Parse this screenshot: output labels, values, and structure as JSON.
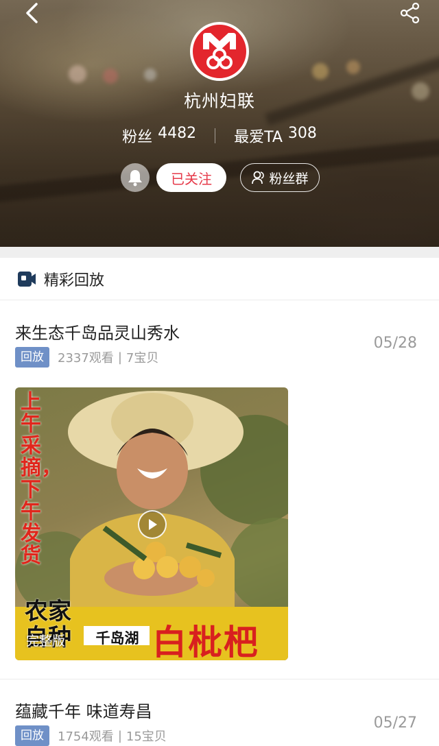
{
  "header": {
    "back_icon": "back-arrow-icon",
    "share_icon": "share-icon",
    "logo_icon": "womens-federation-emblem-icon",
    "name": "杭州妇联",
    "fans_label": "粉丝",
    "fans_count": "4482",
    "favorite_label": "最爱TA",
    "favorite_count": "308",
    "bell_icon": "bell-icon",
    "follow_label": "已关注",
    "fans_group_label": "粉丝群",
    "fans_group_icon": "group-icon"
  },
  "section": {
    "icon": "video-camera-icon",
    "title": "精彩回放"
  },
  "items": [
    {
      "title": "来生态千岛品灵山秀水",
      "badge": "回放",
      "views": "2337观看",
      "separator": "|",
      "goods": "7宝贝",
      "date": "05/28",
      "thumb": {
        "vertical_text": "上午采摘，下午发货",
        "bottom_left": "农家自种",
        "brand": "千岛湖",
        "product": "白枇杷",
        "full_label": "完整版",
        "play_icon": "play-icon"
      }
    },
    {
      "title": "蕴藏千年 味道寿昌",
      "badge": "回放",
      "views": "1754观看",
      "separator": "|",
      "goods": "15宝贝",
      "date": "05/27"
    }
  ],
  "colors": {
    "accent_red": "#e63a4a",
    "badge_blue": "#6f90c7",
    "logo_red": "#e3262d"
  }
}
